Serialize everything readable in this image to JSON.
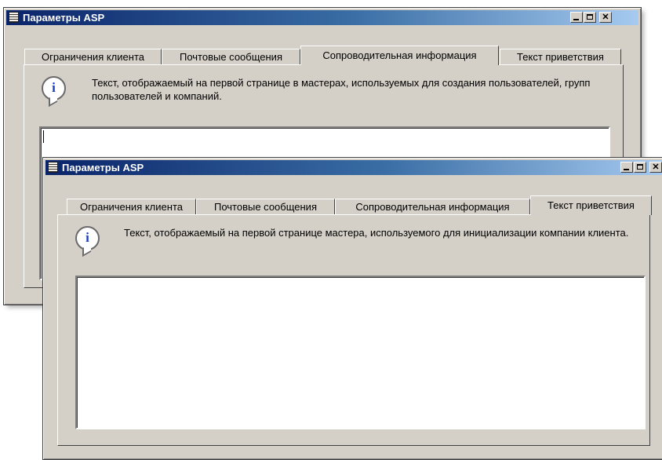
{
  "window_back": {
    "title": "Параметры ASP",
    "tabs": [
      {
        "label": "Ограничения клиента"
      },
      {
        "label": "Почтовые сообщения"
      },
      {
        "label": "Сопроводительная информация",
        "active": true
      },
      {
        "label": "Текст приветствия"
      }
    ],
    "description": "Текст, отображаемый на первой странице в мастерах, используемых для создания пользователей, групп пользователей и компаний.",
    "text_value": ""
  },
  "window_front": {
    "title": "Параметры ASP",
    "tabs": [
      {
        "label": "Ограничения клиента"
      },
      {
        "label": "Почтовые сообщения"
      },
      {
        "label": "Сопроводительная информация"
      },
      {
        "label": "Текст приветствия",
        "active": true
      }
    ],
    "description": "Текст, отображаемый на первой странице мастера, используемого для инициализации компании клиента.",
    "text_value": ""
  },
  "icons": {
    "app": "app-window-icon",
    "info": "info-icon",
    "info_letter": "i",
    "minimize": "minimize-icon",
    "maximize": "maximize-icon",
    "close": "close-icon"
  },
  "colors": {
    "titlebar_start": "#0a246a",
    "titlebar_end": "#a6caf0",
    "face": "#d4d0c8"
  }
}
